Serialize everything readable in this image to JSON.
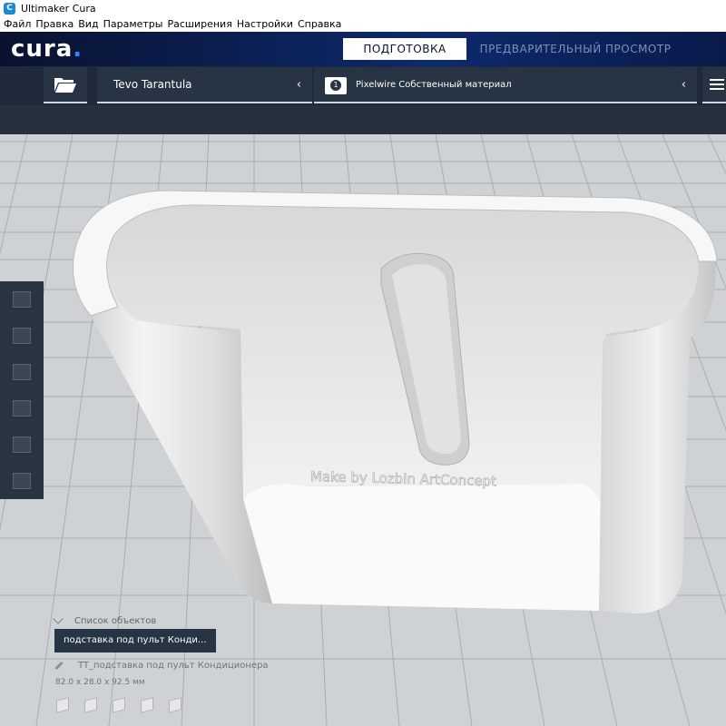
{
  "window": {
    "title": "Ultimaker Cura",
    "app_icon": "cura-app-icon"
  },
  "menu": {
    "items": [
      "Файл",
      "Правка",
      "Вид",
      "Параметры",
      "Расширения",
      "Настройки",
      "Справка"
    ]
  },
  "header": {
    "logo_text": "cura",
    "logo_dot": ".",
    "tabs": [
      {
        "label": "ПОДГОТОВКА",
        "active": true
      },
      {
        "label": "ПРЕДВАРИТЕЛЬНЫЙ ПРОСМОТР",
        "active": false
      }
    ]
  },
  "toolbar": {
    "open_icon": "folder-open-icon",
    "printer": "Tevo Tarantula",
    "material_badge": "1",
    "material": "Pixelwire Собственный материал",
    "chevron": "‹",
    "settings_icon": "print-settings-icon"
  },
  "viewport": {
    "model_engraving": "Make by Lozbin ArtConcept",
    "colors": {
      "build_plate": "#cfd2d4",
      "grid": "#a9adb1",
      "model": "#e8e8e8"
    }
  },
  "tools": [
    "move-tool-icon",
    "scale-tool-icon",
    "rotate-tool-icon",
    "mirror-tool-icon",
    "per-model-settings-icon",
    "support-blocker-icon"
  ],
  "object_list": {
    "title": "Список объектов",
    "items": [
      "подставка под пульт Конди..."
    ],
    "job_name": "TT_подставка под пульт Кондиционера",
    "dimensions": "82.0 x 28.0 x 92.5 мм"
  },
  "view_buttons": [
    "3d-view-icon",
    "front-view-icon",
    "top-view-icon",
    "left-view-icon",
    "right-view-icon"
  ]
}
